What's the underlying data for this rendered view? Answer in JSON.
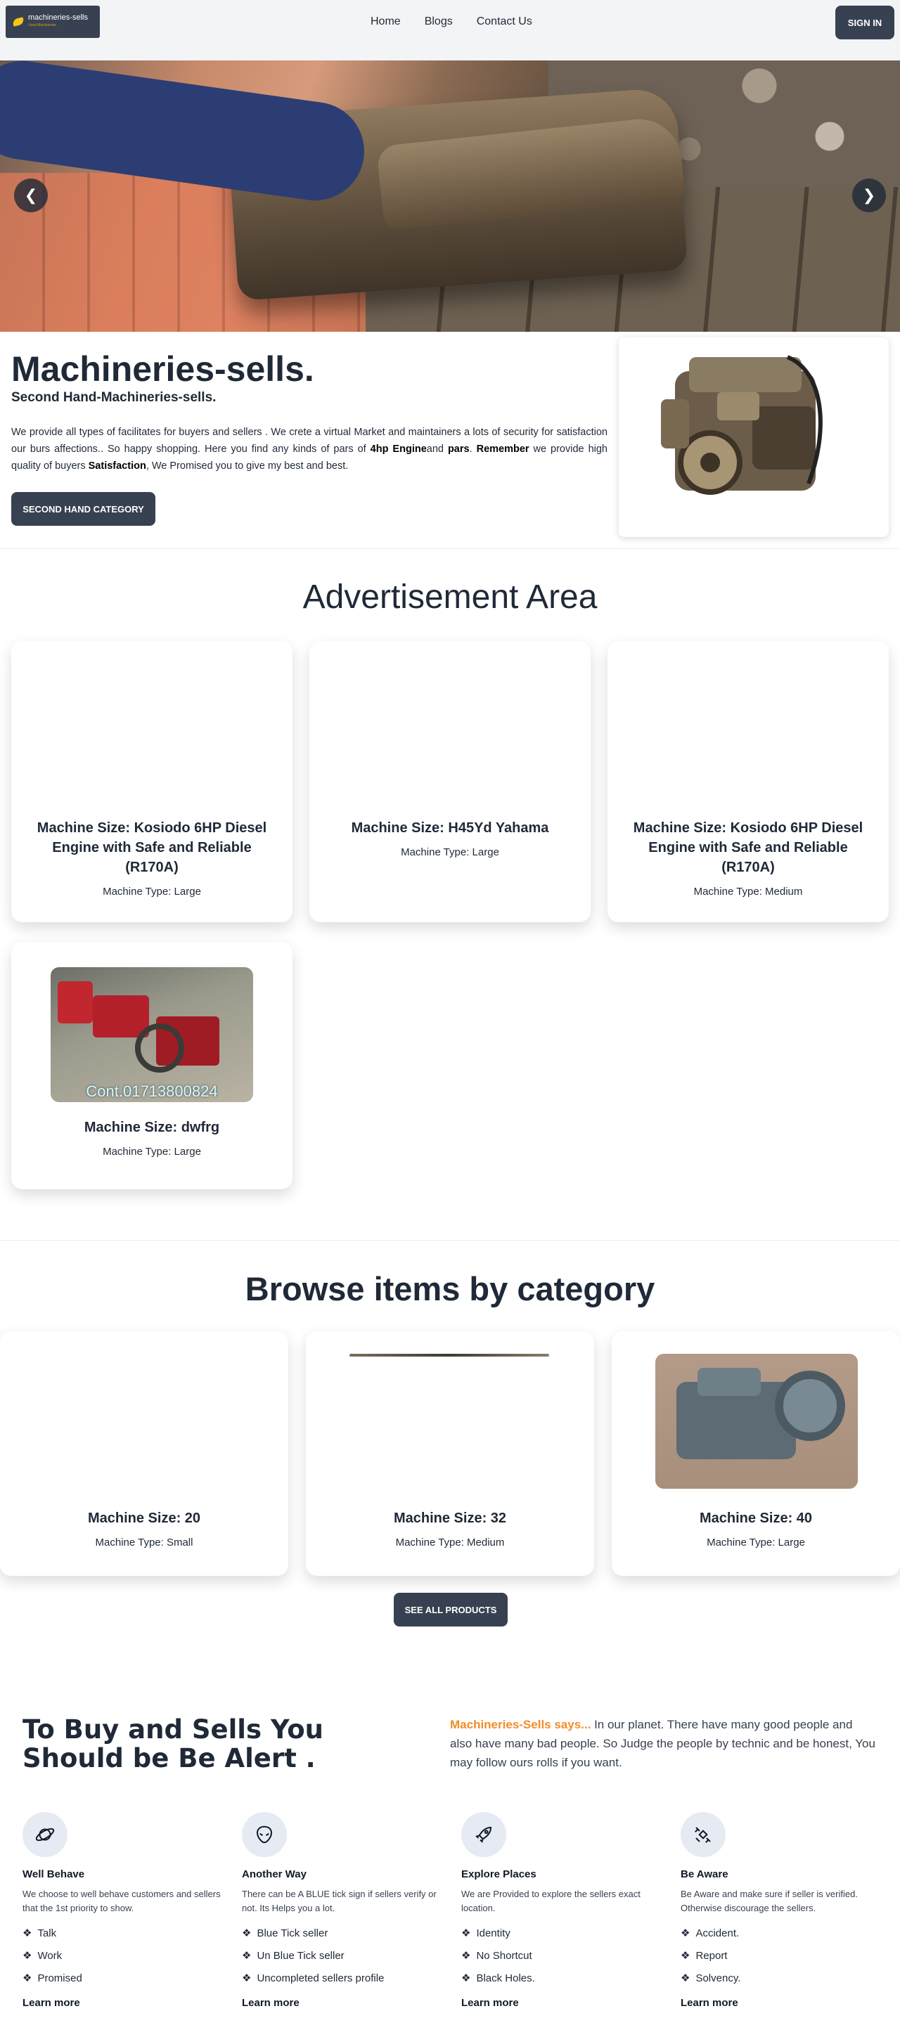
{
  "nav": {
    "logo_text": "machineries-sells",
    "logo_sub": "Used Machineries",
    "links": [
      "Home",
      "Blogs",
      "Contact Us"
    ],
    "signin": "SIGN IN"
  },
  "hero": {
    "prev": "❮",
    "next": "❯"
  },
  "intro": {
    "title": "Machineries-sells.",
    "subtitle": "Second Hand-Machineries-sells.",
    "p1": "We provide all types of facilitates for buyers and sellers . We crete a virtual Market and maintainers a lots of security for satisfaction our burs affections.. So happy shopping. Here you find any kinds of pars of ",
    "b1": "4hp Engine",
    "p2": "and ",
    "b2": "pars",
    "p3": ". ",
    "b3": "Remember",
    "p4": " we provide high quality of buyers ",
    "b4": "Satisfaction",
    "p5": ", We Promised you to give my best and best.",
    "button": "SECOND HAND CATEGORY"
  },
  "advert": {
    "title": "Advertisement Area",
    "cards": [
      {
        "size": "Machine Size: Kosiodo 6HP Diesel Engine with Safe and Reliable (R170A)",
        "type": "Machine Type: Large"
      },
      {
        "size": "Machine Size: H45Yd Yahama",
        "type": "Machine Type: Large"
      },
      {
        "size": "Machine Size: Kosiodo 6HP Diesel Engine with Safe and Reliable (R170A)",
        "type": "Machine Type: Medium"
      },
      {
        "size": "Machine Size: dwfrg",
        "type": "Machine Type: Large",
        "photo_caption": "Cont.01713800824"
      }
    ]
  },
  "category": {
    "title": "Browse items by category",
    "cards": [
      {
        "size": "Machine Size: 20",
        "type": "Machine Type: Small"
      },
      {
        "size": "Machine Size: 32",
        "type": "Machine Type: Medium"
      },
      {
        "size": "Machine Size: 40",
        "type": "Machine Type: Large"
      }
    ],
    "see_all": "SEE ALL PRODUCTS"
  },
  "alert": {
    "title": "To Buy and Sells You Should be Be Alert .",
    "brand": "Machineries-Sells says...",
    "text": " In our planet. There have many good people and also have many bad people. So Judge the people by technic and be honest, You may follow ours rolls if you want."
  },
  "features": [
    {
      "icon": "planet-icon",
      "title": "Well Behave",
      "desc": "We choose to well behave customers and sellers that the 1st priority to show.",
      "items": [
        "Talk",
        "Work",
        "Promised"
      ],
      "learn": "Learn more"
    },
    {
      "icon": "alien-icon",
      "title": "Another Way",
      "desc": "There can be A BLUE tick sign if sellers verify or not. Its Helps you a lot.",
      "items": [
        "Blue Tick seller",
        "Un Blue Tick seller",
        "Uncompleted sellers profile"
      ],
      "learn": "Learn more"
    },
    {
      "icon": "rocket-icon",
      "title": "Explore Places",
      "desc": "We are Provided to explore the sellers exact location.",
      "items": [
        "Identity",
        "No Shortcut",
        "Black Holes."
      ],
      "learn": "Learn more"
    },
    {
      "icon": "satellite-icon",
      "title": "Be Aware",
      "desc": "Be Aware and make sure if seller is verified. Otherwise discourage the sellers.",
      "items": [
        "Accident.",
        "Report",
        "Solvency."
      ],
      "learn": "Learn more"
    }
  ],
  "bullet": "❖",
  "colors": {
    "primary": "#374151",
    "accent": "#f28c28",
    "background": "#f3f4f6",
    "icon_bg": "#e5eaf3"
  }
}
